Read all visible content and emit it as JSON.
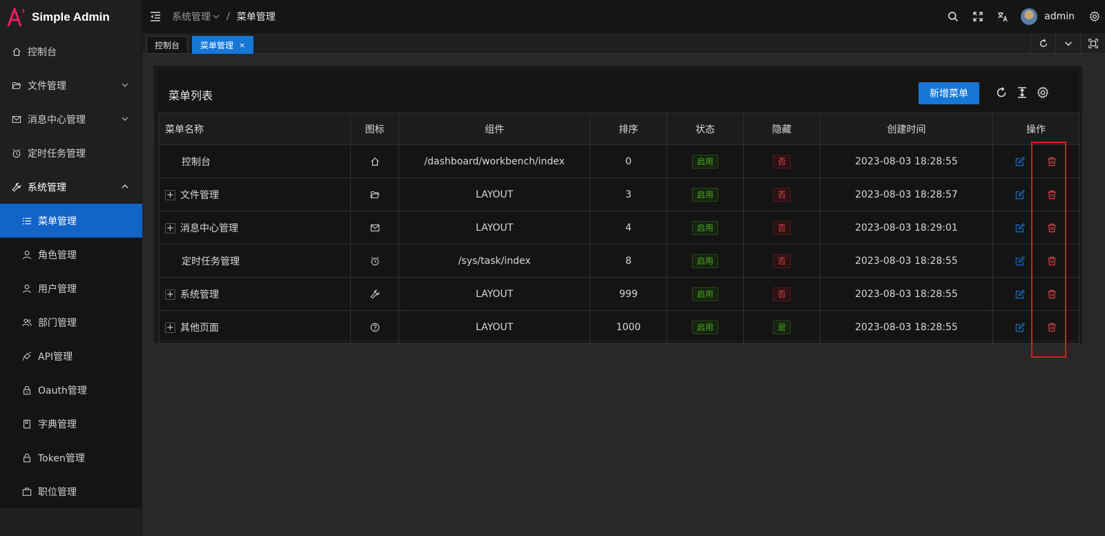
{
  "app": {
    "name": "Simple Admin",
    "logo_color": "#e91e63"
  },
  "sidebar": {
    "items": [
      {
        "label": "控制台",
        "icon": "home-icon"
      },
      {
        "label": "文件管理",
        "icon": "folder-icon",
        "has_children": true
      },
      {
        "label": "消息中心管理",
        "icon": "mail-icon",
        "has_children": true
      },
      {
        "label": "定时任务管理",
        "icon": "alarm-icon"
      },
      {
        "label": "系统管理",
        "icon": "tool-icon",
        "has_children": true,
        "expanded": true
      }
    ],
    "submenu": [
      {
        "label": "菜单管理",
        "icon": "list-icon",
        "active": true
      },
      {
        "label": "角色管理",
        "icon": "user-icon"
      },
      {
        "label": "用户管理",
        "icon": "user-icon"
      },
      {
        "label": "部门管理",
        "icon": "team-icon"
      },
      {
        "label": "API管理",
        "icon": "api-icon"
      },
      {
        "label": "Oauth管理",
        "icon": "lock-icon"
      },
      {
        "label": "字典管理",
        "icon": "book-icon"
      },
      {
        "label": "Token管理",
        "icon": "lock-icon"
      },
      {
        "label": "职位管理",
        "icon": "briefcase-icon"
      }
    ]
  },
  "header": {
    "breadcrumb_parent": "系统管理",
    "breadcrumb_separator": "/",
    "breadcrumb_current": "菜单管理",
    "username": "admin"
  },
  "tabs": [
    {
      "label": "控制台",
      "active": false
    },
    {
      "label": "菜单管理",
      "active": true,
      "close": "×"
    }
  ],
  "card": {
    "title": "菜单列表",
    "add_button": "新增菜单"
  },
  "table": {
    "columns": [
      "菜单名称",
      "图标",
      "组件",
      "排序",
      "状态",
      "隐藏",
      "创建时间",
      "操作"
    ],
    "rows": [
      {
        "name": "控制台",
        "expandable": false,
        "icon": "home-icon",
        "component": "/dashboard/workbench/index",
        "sort": "0",
        "status": "启用",
        "hidden": "否",
        "created": "2023-08-03 18:28:55"
      },
      {
        "name": "文件管理",
        "expandable": true,
        "icon": "folder-icon",
        "component": "LAYOUT",
        "sort": "3",
        "status": "启用",
        "hidden": "否",
        "created": "2023-08-03 18:28:57"
      },
      {
        "name": "消息中心管理",
        "expandable": true,
        "icon": "mail-icon",
        "component": "LAYOUT",
        "sort": "4",
        "status": "启用",
        "hidden": "否",
        "created": "2023-08-03 18:29:01"
      },
      {
        "name": "定时任务管理",
        "expandable": false,
        "icon": "alarm-icon",
        "component": "/sys/task/index",
        "sort": "8",
        "status": "启用",
        "hidden": "否",
        "created": "2023-08-03 18:28:55"
      },
      {
        "name": "系统管理",
        "expandable": true,
        "icon": "tool-icon",
        "component": "LAYOUT",
        "sort": "999",
        "status": "启用",
        "hidden": "否",
        "created": "2023-08-03 18:28:55"
      },
      {
        "name": "其他页面",
        "expandable": true,
        "icon": "question-icon",
        "component": "LAYOUT",
        "sort": "1000",
        "status": "启用",
        "hidden": "是",
        "created": "2023-08-03 18:28:55"
      }
    ],
    "expand_symbol": "+"
  },
  "colors": {
    "primary": "#1677d6",
    "success": "#49aa19",
    "danger": "#e84749",
    "highlight": "#e5191c"
  }
}
